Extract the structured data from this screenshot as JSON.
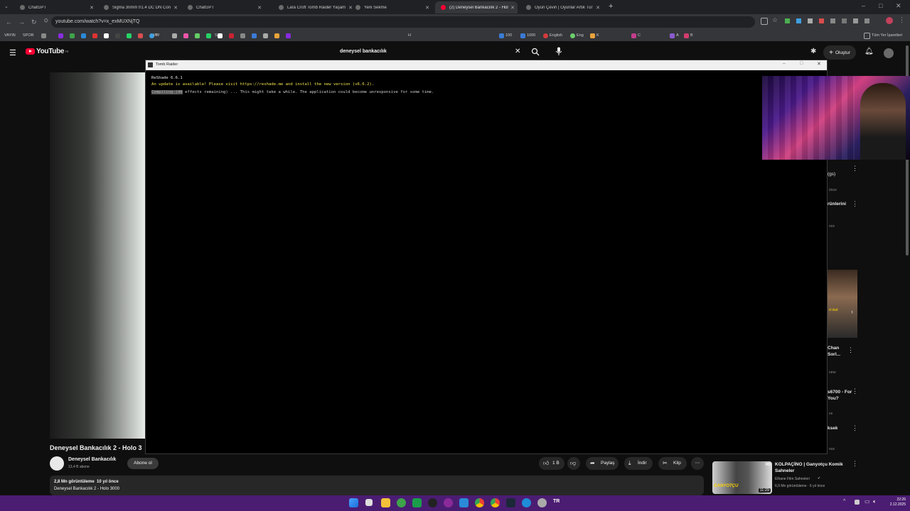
{
  "browser": {
    "tabs": [
      {
        "title": "ChatGPT",
        "active": false
      },
      {
        "title": "Sigma 30mm f/1.4 DC DN Con",
        "active": false
      },
      {
        "title": "ChatGPT",
        "active": false
      },
      {
        "title": "Lara Croft Tomb Raider Yaşam",
        "active": false
      },
      {
        "title": "Yeni Sekme",
        "active": false
      },
      {
        "title": "(2) Deneysel Bankacılık 2 - Hol",
        "active": true
      },
      {
        "title": "Oyun Çeviri | Oyunlar Artık Tür",
        "active": false
      }
    ],
    "url": "youtube.com/watch?v=x_exMUXNjTQ",
    "bookmarks_left": [
      "VAYIN",
      "SPOR"
    ],
    "bookmarks_items": [
      "W",
      "IP",
      "S",
      "H",
      "100",
      "1000",
      "English",
      "Eng",
      "K",
      "C",
      "A",
      "B"
    ],
    "all_bookmarks": "Tüm Yer İşaretleri"
  },
  "youtube": {
    "logo": "YouTube",
    "logo_sup": "TR",
    "search_value": "deneysel bankacılık",
    "create_label": "Oluştur",
    "video_title": "Deneysel Bankacılık 2 - Holo 3",
    "channel_name": "Deneysel Bankacılık",
    "subscribers": "13,4 B abone",
    "subscribe_label": "Abone ol",
    "likes": "1 B",
    "share_label": "Paylaş",
    "download_label": "İndir",
    "clip_label": "Klip",
    "views_line": "2,8 Mn görüntüleme  10 yıl önce",
    "desc_line": "Deneysel Bankacılık 2 - Holo 3000",
    "sidebar": [
      {
        "title": "(gs)",
        "sub": "önce"
      },
      {
        "title": "rünlerini",
        "sub": "nce"
      },
      {
        "title": "Chan Sorl...",
        "sub": "nme"
      },
      {
        "title": "s6700 - For You?",
        "sub": "ce"
      },
      {
        "title": "ksek",
        "sub": "nce"
      }
    ],
    "overlay_caption": "d dad",
    "rec_video": {
      "title": "KOLPAÇİNO | Ganyotçu Komik Sahneler",
      "channel": "Elhane Film Sahneleri",
      "meta": "6,9 Mn görüntüleme · 6 yıl önce",
      "duration": "11:29",
      "badge": "HD",
      "thumb_text": "GANYOTÇU"
    }
  },
  "app_window": {
    "title": "Tomb Raider",
    "lines": [
      {
        "text": "ReShade 6.6.1",
        "color": "#e8e8e8"
      },
      {
        "text": "An update is available! Please visit https://reshade.me and install the new version (v6.6.2).",
        "color": "#f2e34b"
      },
      {
        "highlight": "Compiling (46",
        "rest": " effects remaining) ... This might take a while. The application could become unresponsive for some time.",
        "color": "#d0d0d0"
      }
    ]
  },
  "taskbar": {
    "lang": "TR",
    "time": "22:26",
    "date": "2.12.2025"
  }
}
